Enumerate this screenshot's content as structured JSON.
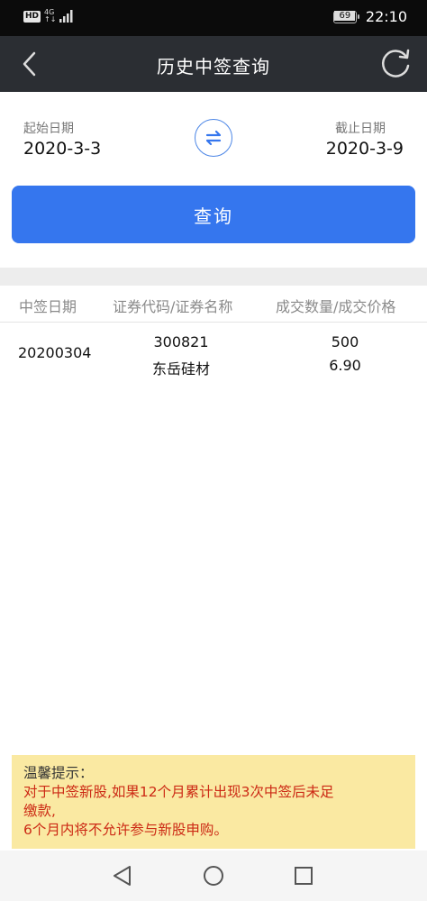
{
  "status_bar": {
    "hd_label": "HD",
    "network_label": "4G",
    "network_sub": "↑↓",
    "battery_level": "69",
    "time": "22:10"
  },
  "nav": {
    "title": "历史中签查询",
    "back_icon": "chevron-left-icon",
    "refresh_icon": "refresh-icon"
  },
  "date_range": {
    "start_label": "起始日期",
    "start_value": "2020-3-3",
    "end_label": "截止日期",
    "end_value": "2020-3-9",
    "swap_icon": "swap-arrows-icon"
  },
  "query_button": {
    "label": "查询"
  },
  "table": {
    "headers": [
      "中签日期",
      "证券代码/证券名称",
      "成交数量/成交价格"
    ],
    "rows": [
      {
        "date": "20200304",
        "code": "300821",
        "name": "东岳硅材",
        "quantity": "500",
        "price": "6.90"
      }
    ]
  },
  "tip": {
    "title": "温馨提示：",
    "line1": "对于中签新股,如果12个月累计出现3次中签后未足",
    "line2": "缴款,",
    "line3": "6个月内将不允许参与新股申购。"
  },
  "system_nav": {
    "back_icon": "triangle-back-icon",
    "home_icon": "circle-home-icon",
    "recents_icon": "square-recents-icon"
  },
  "colors": {
    "nav_bg": "#2b2e33",
    "accent": "#3576ee",
    "tip_bg": "#fae9a2",
    "tip_text": "#cc2a15"
  }
}
